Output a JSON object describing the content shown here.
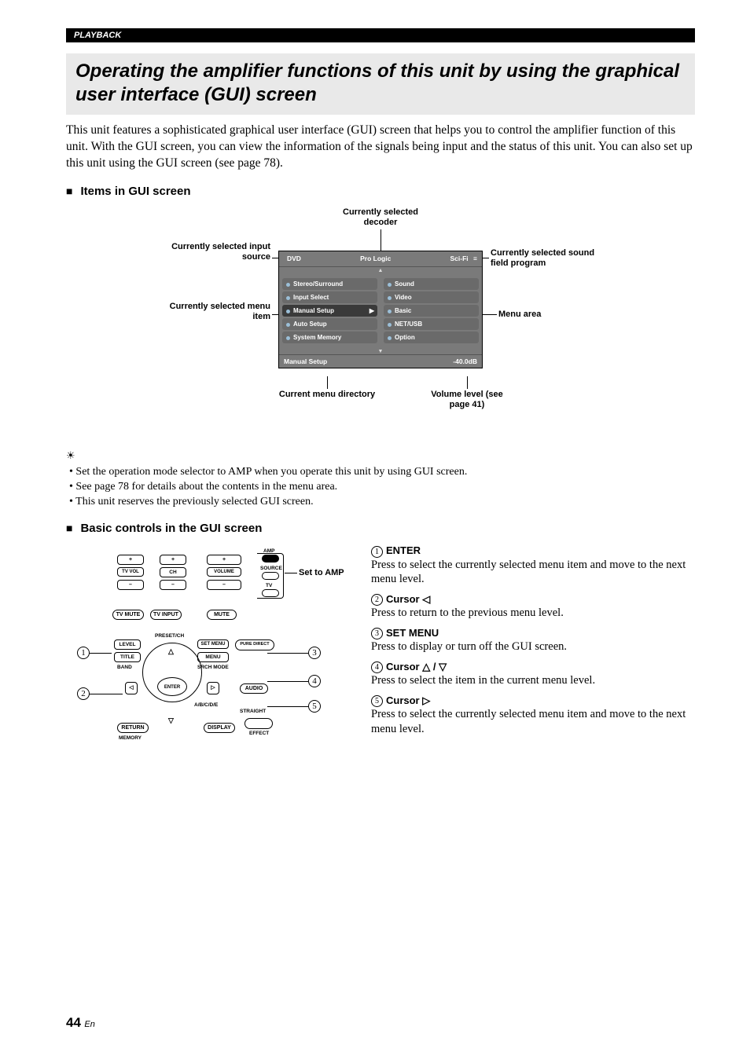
{
  "header_tag": "PLAYBACK",
  "title": "Operating the amplifier functions of this unit by using the graphical user interface (GUI) screen",
  "intro": "This unit features a sophisticated graphical user interface (GUI) screen that helps you to control the amplifier function of this unit. With the GUI screen, you can view the information of the signals being input and the status of this unit. You can also set up this unit using the GUI screen (see page 78).",
  "h_items": "Items in GUI screen",
  "gui": {
    "top": {
      "source": "DVD",
      "decoder": "Pro Logic",
      "program": "Sci-Fi"
    },
    "left_col": [
      "Stereo/Surround",
      "Input Select",
      "Manual Setup",
      "Auto Setup",
      "System Memory"
    ],
    "right_col": [
      "Sound",
      "Video",
      "Basic",
      "NET/USB",
      "Option"
    ],
    "bottom": {
      "dir": "Manual Setup",
      "vol": "-40.0dB"
    }
  },
  "ann": {
    "decoder": "Currently selected decoder",
    "input": "Currently selected input source",
    "item": "Currently selected menu item",
    "program": "Currently selected sound field program",
    "menu": "Menu area",
    "dir": "Current menu directory",
    "vol": "Volume level (see page 41)"
  },
  "hints": [
    "Set the operation mode selector to AMP when you operate this unit by using GUI screen.",
    "See page 78 for details about the contents in the menu area.",
    "This unit reserves the previously selected GUI screen."
  ],
  "h_basic": "Basic controls in the GUI screen",
  "set_amp": "Set to AMP",
  "remote": {
    "plus": "+",
    "minus": "–",
    "tvvol": "TV VOL",
    "ch": "CH",
    "volume": "VOLUME",
    "amp": "AMP",
    "source": "SOURCE",
    "tv": "TV",
    "tvmute": "TV MUTE",
    "tvinput": "TV INPUT",
    "mute": "MUTE",
    "level": "LEVEL",
    "title": "TITLE",
    "band": "BAND",
    "presetch": "PRESET/CH",
    "setmenu": "SET MENU",
    "menu": "MENU",
    "srchmode": "SRCH MODE",
    "puredirect": "PURE DIRECT",
    "audio": "AUDIO",
    "enter": "ENTER",
    "abcde": "A/B/C/D/E",
    "straight": "STRAIGHT",
    "return": "RETURN",
    "memory": "MEMORY",
    "display": "DISPLAY",
    "effect": "EFFECT"
  },
  "controls": {
    "c1": {
      "n": "1",
      "h": "ENTER",
      "p": "Press to select the currently selected menu item and move to the next menu level."
    },
    "c2": {
      "n": "2",
      "h": "Cursor ◁",
      "p": "Press to return to the previous menu level."
    },
    "c3": {
      "n": "3",
      "h": "SET MENU",
      "p": "Press to display or turn off the GUI screen."
    },
    "c4": {
      "n": "4",
      "h": "Cursor △ / ▽",
      "p": "Press to select the item in the current menu level."
    },
    "c5": {
      "n": "5",
      "h": "Cursor ▷",
      "p": "Press to select the currently selected menu item and move to the next menu level."
    }
  },
  "page": {
    "num": "44",
    "suf": "En"
  }
}
